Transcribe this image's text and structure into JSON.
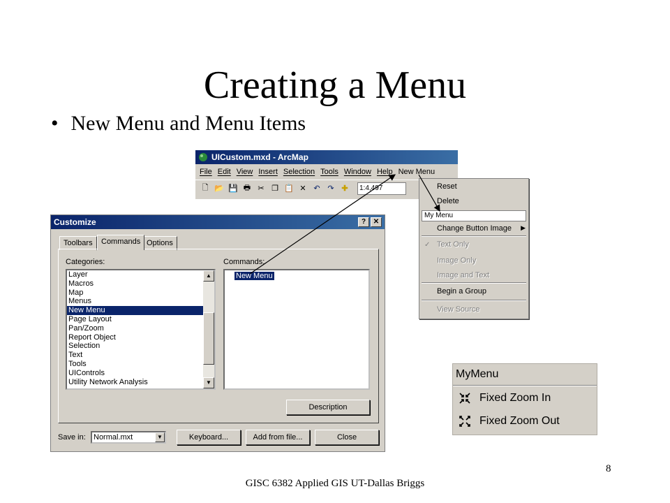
{
  "slide": {
    "title": "Creating a Menu",
    "bullet": "New Menu and Menu Items",
    "footer": "GISC 6382   Applied GIS   UT-Dallas  Briggs",
    "page_number": "8"
  },
  "arcmap": {
    "title": "UICustom.mxd - ArcMap",
    "menus": [
      "File",
      "Edit",
      "View",
      "Insert",
      "Selection",
      "Tools",
      "Window",
      "Help",
      "New Menu"
    ],
    "scale": "1:4,497"
  },
  "context_menu": {
    "items": [
      {
        "label": "Reset",
        "enabled": true
      },
      {
        "label": "Delete",
        "enabled": true
      },
      {
        "label": "Change Button Image",
        "enabled": true
      },
      {
        "label": "Text Only",
        "enabled": false,
        "checked": true
      },
      {
        "label": "Image Only",
        "enabled": false
      },
      {
        "label": "Image and Text",
        "enabled": false
      },
      {
        "label": "Begin a Group",
        "enabled": true
      },
      {
        "label": "View Source",
        "enabled": false
      }
    ],
    "name_field_value": "My Menu"
  },
  "customize": {
    "title": "Customize",
    "tabs": [
      "Toolbars",
      "Commands",
      "Options"
    ],
    "active_tab": "Commands",
    "categories_label": "Categories:",
    "commands_label": "Commands:",
    "categories": [
      "Layer",
      "Macros",
      "Map",
      "Menus",
      "New Menu",
      "Page Layout",
      "Pan/Zoom",
      "Report Object",
      "Selection",
      "Text",
      "Tools",
      "UIControls",
      "Utility Network Analysis"
    ],
    "selected_category": "New Menu",
    "commands": [
      "New Menu"
    ],
    "description_button": "Description",
    "save_in_label": "Save in:",
    "save_in_value": "Normal.mxt",
    "keyboard_button": "Keyboard...",
    "add_from_file_button": "Add from file...",
    "close_button": "Close",
    "help_button": "?",
    "close_x": "✕"
  },
  "mymenu": {
    "title": "MyMenu",
    "items": [
      "Fixed Zoom In",
      "Fixed Zoom Out"
    ]
  }
}
